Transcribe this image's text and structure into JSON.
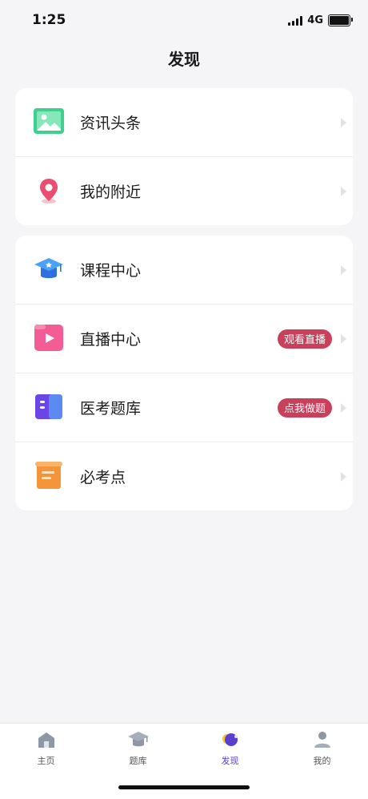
{
  "status_bar": {
    "time": "1:25",
    "network": "4G"
  },
  "header": {
    "title": "发现"
  },
  "groups": [
    {
      "items": [
        {
          "label": "资讯头条",
          "icon": "news-image-icon"
        },
        {
          "label": "我的附近",
          "icon": "location-pin-icon"
        }
      ]
    },
    {
      "items": [
        {
          "label": "课程中心",
          "icon": "graduation-cap-icon"
        },
        {
          "label": "直播中心",
          "icon": "live-video-icon",
          "badge": "观看直播"
        },
        {
          "label": "医考题库",
          "icon": "book-icon",
          "badge": "点我做题"
        },
        {
          "label": "必考点",
          "icon": "scroll-icon"
        }
      ]
    }
  ],
  "tab_bar": {
    "tabs": [
      {
        "label": "主页",
        "icon": "home-icon"
      },
      {
        "label": "题库",
        "icon": "graduation-cap-icon"
      },
      {
        "label": "发现",
        "icon": "discover-icon",
        "active": true
      },
      {
        "label": "我的",
        "icon": "person-icon"
      }
    ]
  },
  "colors": {
    "accent": "#5a3fd1",
    "badge": "#c9405a"
  }
}
